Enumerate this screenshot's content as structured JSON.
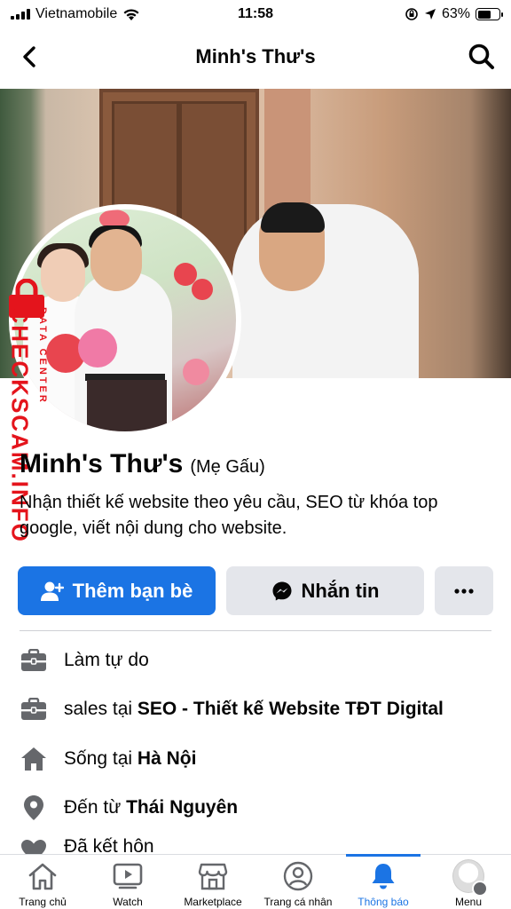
{
  "status_bar": {
    "carrier": "Vietnamobile",
    "time": "11:58",
    "battery": "63%",
    "battery_level": 0.63
  },
  "header": {
    "title": "Minh's Thư's"
  },
  "watermark": {
    "brand": "CHECKSCAM.INFO",
    "tagline": "DATA CENTER"
  },
  "profile": {
    "name": "Minh's Thư's",
    "alt_name": "(Mẹ Gấu)",
    "bio": "Nhận thiết kế website theo yêu cầu, SEO từ khóa top google, viết nội dung cho website."
  },
  "actions": {
    "add_friend": "Thêm bạn bè",
    "message": "Nhắn tin",
    "more": "···"
  },
  "intro": [
    {
      "icon": "briefcase-icon",
      "text": "Làm tự do",
      "bold": ""
    },
    {
      "icon": "briefcase-icon",
      "text": "sales tại ",
      "bold": "SEO - Thiết kế Website TĐT Digital"
    },
    {
      "icon": "home-icon",
      "text": "Sống tại ",
      "bold": "Hà Nội"
    },
    {
      "icon": "location-pin-icon",
      "text": "Đến từ ",
      "bold": "Thái Nguyên"
    },
    {
      "icon": "heart-icon",
      "text": "Đã kết hôn",
      "bold": ""
    }
  ],
  "bottom_nav": [
    {
      "icon": "home-icon",
      "label": "Trang chủ"
    },
    {
      "icon": "video-icon",
      "label": "Watch"
    },
    {
      "icon": "shop-icon",
      "label": "Marketplace"
    },
    {
      "icon": "profile-icon",
      "label": "Trang cá nhân"
    },
    {
      "icon": "bell-icon",
      "label": "Thông báo",
      "active": true
    },
    {
      "icon": "menu-avatar",
      "label": "Menu"
    }
  ],
  "colors": {
    "accent": "#1b74e4",
    "button_gray": "#e4e6eb",
    "watermark_red": "#e4141c"
  }
}
